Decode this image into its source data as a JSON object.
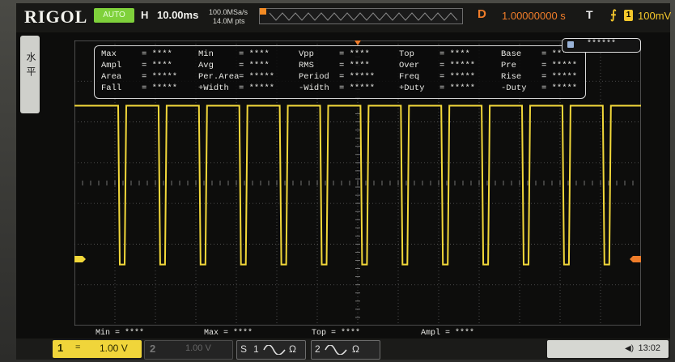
{
  "brand": "RIGOL",
  "mode_badge": "AUTO",
  "timebase": {
    "label": "H",
    "value": "10.00ms"
  },
  "acq": {
    "rate": "100.0MSa/s",
    "points": "14.0M pts"
  },
  "delay": {
    "label": "D",
    "value": "1.00000000 s"
  },
  "trigger": {
    "label": "T",
    "channel": "1",
    "level": "100mV",
    "edge_icon": "rising-edge-icon"
  },
  "left_tab": "水平",
  "meas_badge": "******",
  "measurements": [
    [
      "Max",
      "= ****",
      "Min",
      "= ****",
      "Vpp",
      "= ****",
      "Top",
      "= ****",
      "Base",
      "= ****"
    ],
    [
      "Ampl",
      "= ****",
      "Avg",
      "= ****",
      "RMS",
      "= ****",
      "Over",
      "= *****",
      "Pre",
      "= *****"
    ],
    [
      "Area",
      "= *****",
      "Per.Area",
      "= *****",
      "Period",
      "= *****",
      "Freq",
      "= *****",
      "Rise",
      "= *****"
    ],
    [
      "Fall",
      "= *****",
      "+Width",
      "= *****",
      "-Width",
      "= *****",
      "+Duty",
      "= *****",
      "-Duty",
      "= *****"
    ]
  ],
  "bottom_meas": [
    {
      "label": "Min = ****"
    },
    {
      "label": "Max = ****"
    },
    {
      "label": "Top = ****"
    },
    {
      "label": "Ampl = ****"
    }
  ],
  "channels": [
    {
      "num": "1",
      "coupling": "=",
      "scale": "1.00 V"
    },
    {
      "num": "2",
      "coupling": "=",
      "scale": "1.00 V"
    }
  ],
  "status": {
    "s_label": "S",
    "s1": "1",
    "s2": "2",
    "ohm": "Ω",
    "time": "13:02"
  },
  "colors": {
    "ch1": "#f2d83a",
    "accent": "#f07d2a",
    "grid": "#8c8c8c"
  },
  "waveform": {
    "pulses": 13,
    "high_level_div": 1.9,
    "low_level_div": -2.0
  }
}
